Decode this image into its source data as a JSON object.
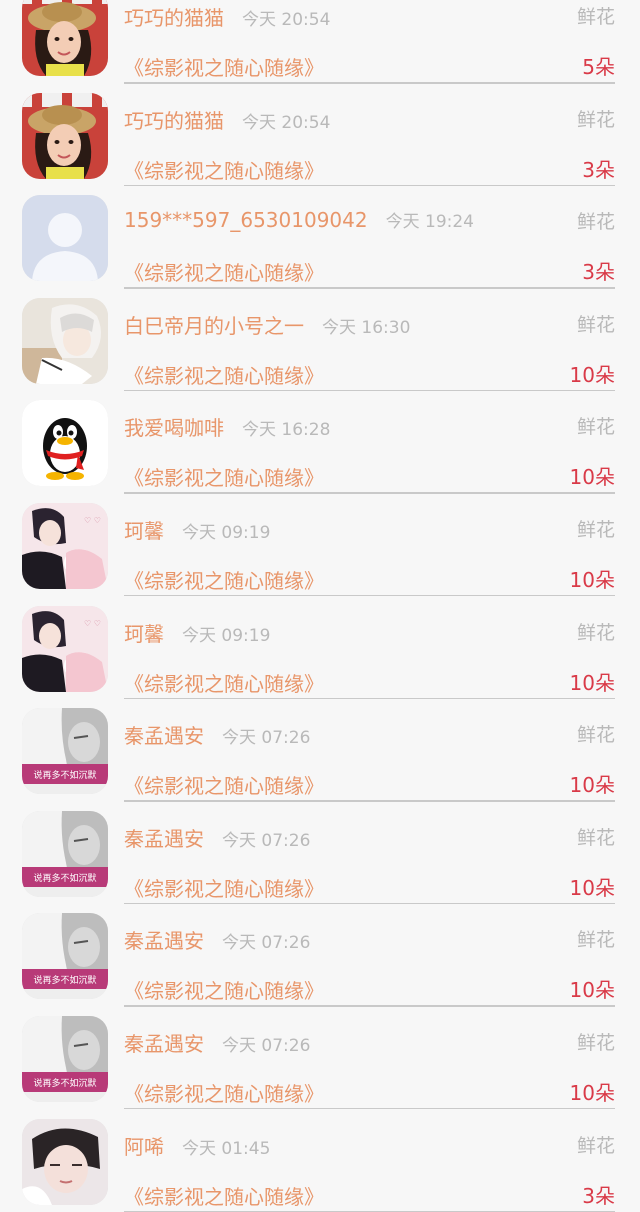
{
  "items": [
    {
      "name": "巧巧的猫猫",
      "time": "今天 20:54",
      "gift": "鲜花",
      "book": "《综影视之随心随缘》",
      "count": "5朵",
      "avatar": "girl-hat-avatar"
    },
    {
      "name": "巧巧的猫猫",
      "time": "今天 20:54",
      "gift": "鲜花",
      "book": "《综影视之随心随缘》",
      "count": "3朵",
      "avatar": "girl-hat-avatar"
    },
    {
      "name": "159***597_6530109042",
      "time": "今天 19:24",
      "gift": "鲜花",
      "book": "《综影视之随心随缘》",
      "count": "3朵",
      "avatar": "default-avatar"
    },
    {
      "name": "白巳帝月的小号之一",
      "time": "今天 16:30",
      "gift": "鲜花",
      "book": "《综影视之随心随缘》",
      "count": "10朵",
      "avatar": "anime-white-hair-avatar"
    },
    {
      "name": "我爱喝咖啡",
      "time": "今天 16:28",
      "gift": "鲜花",
      "book": "《综影视之随心随缘》",
      "count": "10朵",
      "avatar": "qq-penguin-avatar"
    },
    {
      "name": "珂馨",
      "time": "今天 09:19",
      "gift": "鲜花",
      "book": "《综影视之随心随缘》",
      "count": "10朵",
      "avatar": "anime-couple-avatar"
    },
    {
      "name": "珂馨",
      "time": "今天 09:19",
      "gift": "鲜花",
      "book": "《综影视之随心随缘》",
      "count": "10朵",
      "avatar": "anime-couple-avatar"
    },
    {
      "name": "秦孟遇安",
      "time": "今天 07:26",
      "gift": "鲜花",
      "book": "《综影视之随心随缘》",
      "count": "10朵",
      "avatar": "photo-text-banner-avatar"
    },
    {
      "name": "秦孟遇安",
      "time": "今天 07:26",
      "gift": "鲜花",
      "book": "《综影视之随心随缘》",
      "count": "10朵",
      "avatar": "photo-text-banner-avatar"
    },
    {
      "name": "秦孟遇安",
      "time": "今天 07:26",
      "gift": "鲜花",
      "book": "《综影视之随心随缘》",
      "count": "10朵",
      "avatar": "photo-text-banner-avatar"
    },
    {
      "name": "秦孟遇安",
      "time": "今天 07:26",
      "gift": "鲜花",
      "book": "《综影视之随心随缘》",
      "count": "10朵",
      "avatar": "photo-text-banner-avatar"
    },
    {
      "name": "阿唏",
      "time": "今天 01:45",
      "gift": "鲜花",
      "book": "《综影视之随心随缘》",
      "count": "3朵",
      "avatar": "boy-portrait-avatar"
    }
  ],
  "avatar_banner_text": "说再多不如沉默",
  "colors": {
    "name": "#e8966a",
    "time": "#b9b9b9",
    "count": "#d93a48",
    "background": "#f7f7f7"
  }
}
